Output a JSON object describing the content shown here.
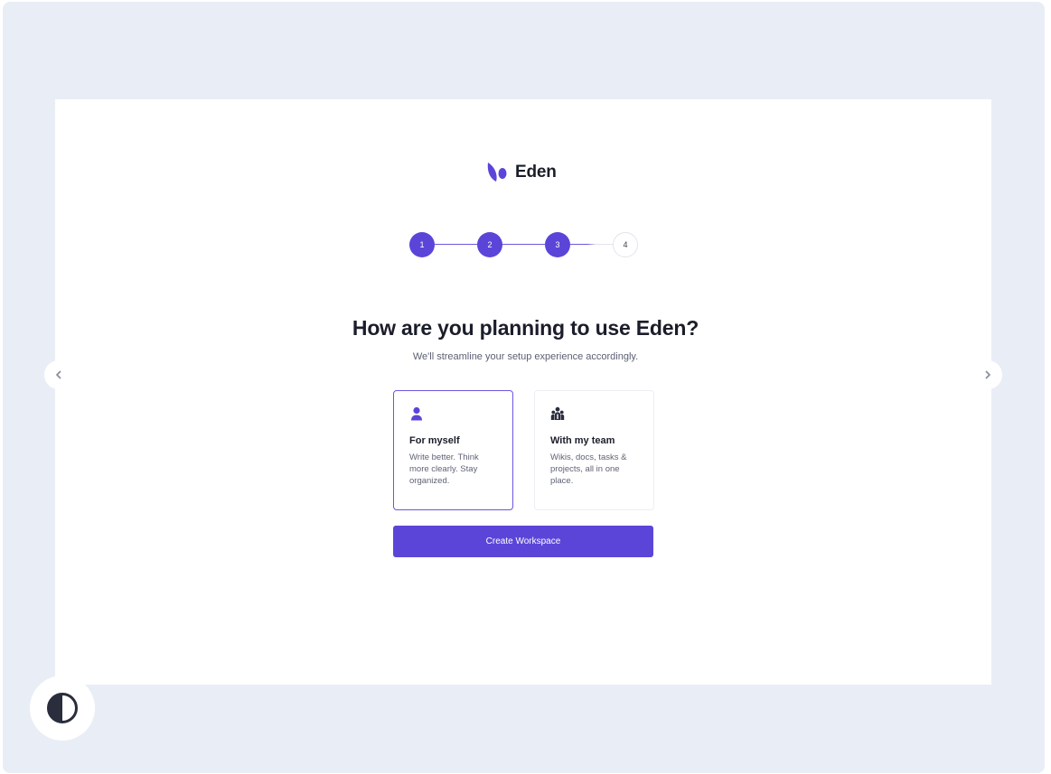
{
  "brand": {
    "name": "Eden",
    "logo_icon": "leaf-logo-icon"
  },
  "stepper": {
    "steps": [
      {
        "label": "1",
        "state": "complete"
      },
      {
        "label": "2",
        "state": "complete"
      },
      {
        "label": "3",
        "state": "current"
      },
      {
        "label": "4",
        "state": "upcoming"
      }
    ]
  },
  "heading": {
    "title": "How are you planning to use Eden?",
    "subtitle": "We'll streamline your setup experience accordingly."
  },
  "options": [
    {
      "icon": "person-icon",
      "title": "For myself",
      "description": "Write better. Think more clearly. Stay organized.",
      "selected": true
    },
    {
      "icon": "team-icon",
      "title": "With my team",
      "description": "Wikis, docs, tasks & projects, all in one place.",
      "selected": false
    }
  ],
  "cta": {
    "label": "Create Workspace"
  },
  "navigation": {
    "prev_icon": "chevron-left-icon",
    "next_icon": "chevron-right-icon"
  },
  "theme_toggle": {
    "icon": "contrast-icon"
  },
  "colors": {
    "accent": "#5b45d8",
    "frame_background": "#e9eef6",
    "card_background": "#ffffff",
    "text_primary": "#1b1d2a",
    "text_secondary": "#5b6072"
  }
}
